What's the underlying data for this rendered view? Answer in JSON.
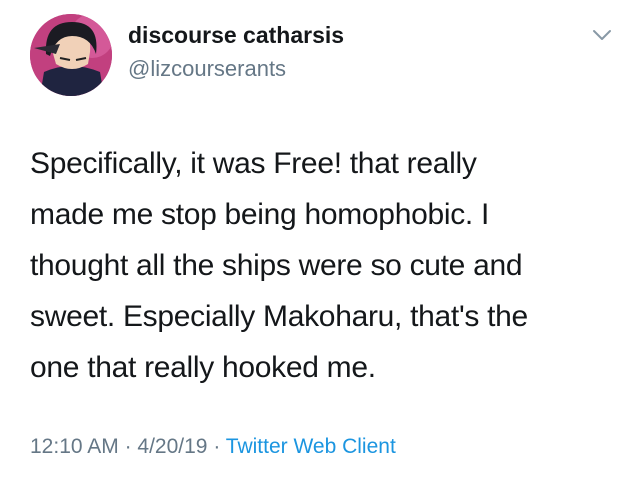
{
  "author": {
    "display_name": "discourse catharsis",
    "handle": "@lizcourserants",
    "avatar": "anime-character-avatar"
  },
  "tweet": {
    "lines": [
      "Specifically, it was Free! that really",
      "made me stop being homophobic. I",
      "thought all the ships were so cute and",
      "sweet. Especially Makoharu, that's the",
      "one that really hooked me."
    ]
  },
  "meta": {
    "time": "12:10 AM",
    "separator_1": " · ",
    "date": "4/20/19",
    "separator_2": " · ",
    "source": "Twitter Web Client"
  },
  "colors": {
    "text": "#14171a",
    "secondary": "#657786",
    "link": "#1b95e0"
  },
  "icons": {
    "menu": "chevron-down-icon"
  }
}
